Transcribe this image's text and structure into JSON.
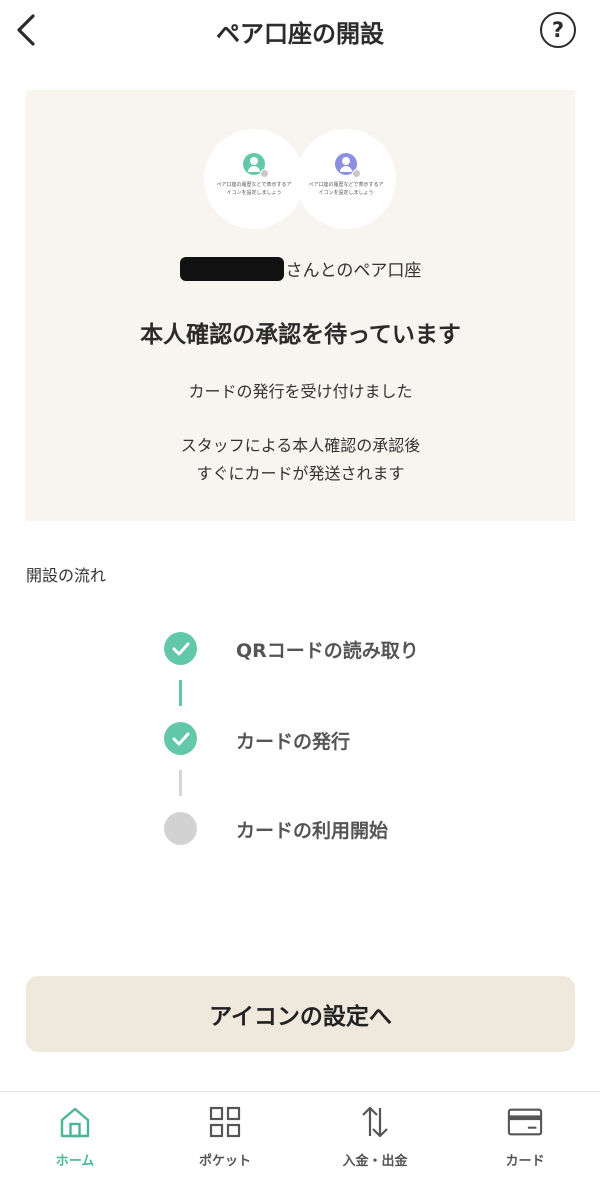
{
  "header": {
    "title": "ペア口座の開設",
    "back_icon": "chevron-left-icon",
    "help_label": "?"
  },
  "status_card": {
    "avatars": [
      {
        "text": "ペア口座の履歴などで表示するアイコンを設定しましょう",
        "color": "#63c7a9"
      },
      {
        "text": "ペア口座の履歴などで表示するアイコンを設定しましょう",
        "color": "#8b8fe0"
      }
    ],
    "partner_suffix": "さんとのペア口座",
    "heading": "本人確認の承認を待っています",
    "line1": "カードの発行を受け付けました",
    "line2": "スタッフによる本人確認の承認後",
    "line3": "すぐにカードが発送されます"
  },
  "flow": {
    "title": "開設の流れ",
    "steps": [
      {
        "label": "QRコードの読み取り",
        "done": true
      },
      {
        "label": "カードの発行",
        "done": true
      },
      {
        "label": "カードの利用開始",
        "done": false
      }
    ]
  },
  "cta": {
    "label": "アイコンの設定へ"
  },
  "bottom_nav": {
    "items": [
      {
        "label": "ホーム",
        "icon": "home-icon",
        "active": true
      },
      {
        "label": "ポケット",
        "icon": "grid-icon",
        "active": false
      },
      {
        "label": "入金・出金",
        "icon": "transfer-arrows-icon",
        "active": false
      },
      {
        "label": "カード",
        "icon": "card-icon",
        "active": false
      }
    ]
  },
  "colors": {
    "accent": "#63c7a9",
    "card_bg": "#f8f5f0",
    "cta_bg": "#efe9dd",
    "inactive_step": "#d2d2d2"
  }
}
